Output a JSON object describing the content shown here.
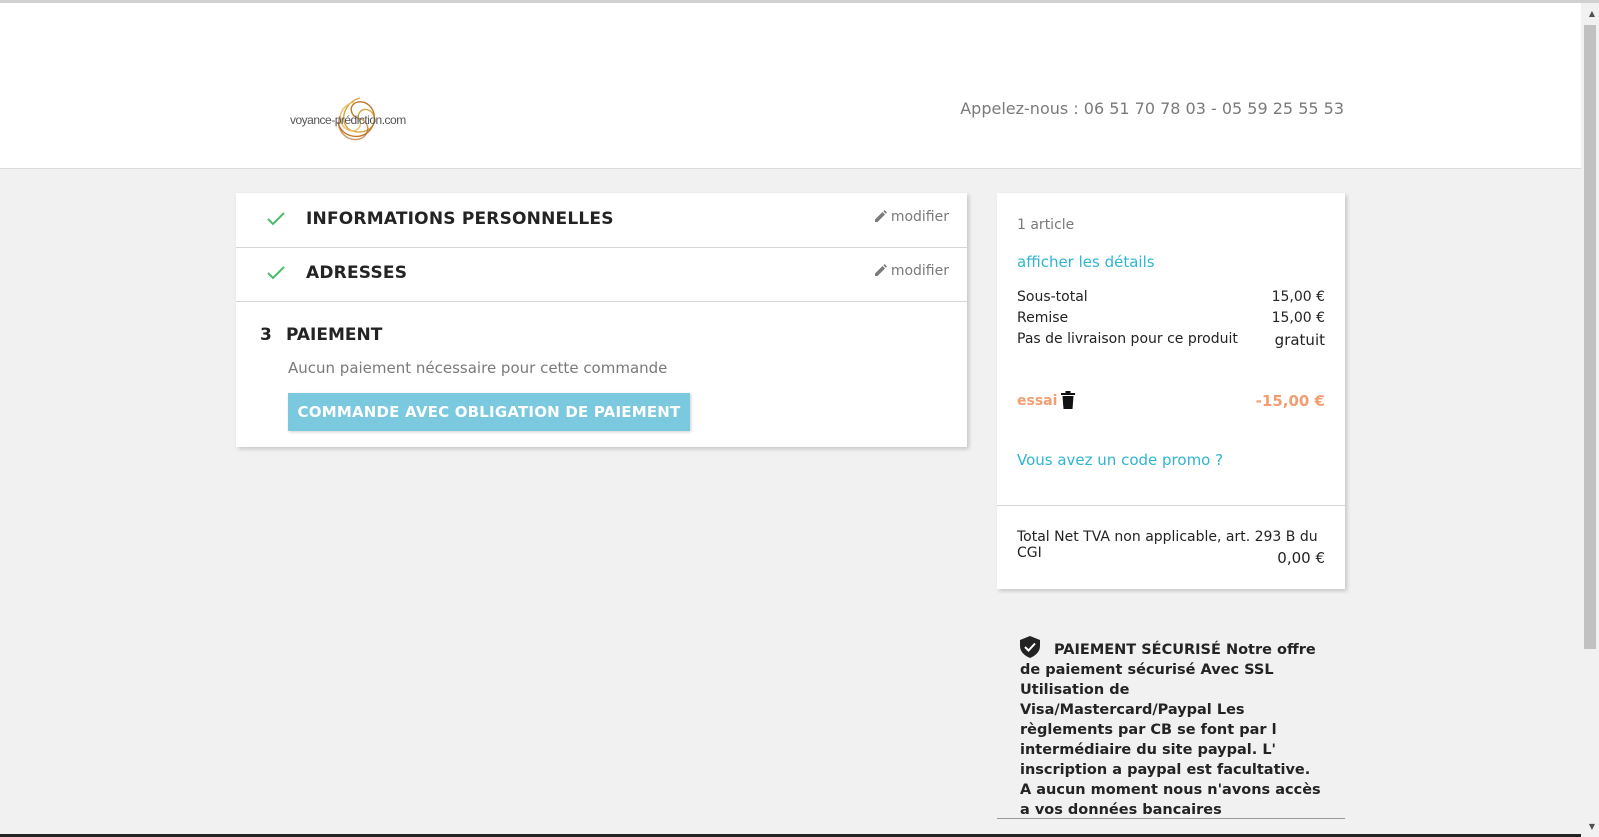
{
  "header": {
    "logo_text": "voyance-prédiction.com",
    "phone": "Appelez-nous : 06 51 70 78 03 - 05 59 25 55 53"
  },
  "steps": [
    {
      "title": "INFORMATIONS PERSONNELLES",
      "action": "modifier"
    },
    {
      "title": "ADRESSES",
      "action": "modifier"
    }
  ],
  "payment": {
    "number": "3",
    "title": "PAIEMENT",
    "note": "Aucun paiement nécessaire pour cette commande",
    "button_label": "COMMANDE AVEC OBLIGATION DE PAIEMENT"
  },
  "summary": {
    "count": "1 article",
    "details_link": "afficher les détails",
    "lines": [
      {
        "label": "Sous-total",
        "value": "15,00 €"
      },
      {
        "label": "Remise",
        "value": "15,00 €"
      },
      {
        "label": "Pas de livraison pour ce produit",
        "value": "gratuit"
      }
    ],
    "voucher": {
      "name": "essai",
      "value": "-15,00 €"
    },
    "promo_link": "Vous avez un code promo ?",
    "total_label": "Total Net TVA non applicable, art. 293 B du CGI",
    "total_value": "0,00 €"
  },
  "secure": {
    "text": "PAIEMENT SÉCURISÉ Notre offre de paiement sécurisé Avec SSL Utilisation de Visa/Mastercard/Paypal Les règlements par CB se font par l intermédiaire du site paypal. L' inscription a paypal est facultative. A aucun moment nous n'avons accès a vos données bancaires"
  },
  "colors": {
    "accent_blue": "#2fb5d2",
    "button_bg": "#7ac9df",
    "check_green": "#4cbb6c",
    "voucher_orange": "#f39d72"
  },
  "icons": [
    "spiral-logo-icon",
    "check-icon",
    "pencil-icon",
    "trash-icon",
    "shield-check-icon"
  ]
}
